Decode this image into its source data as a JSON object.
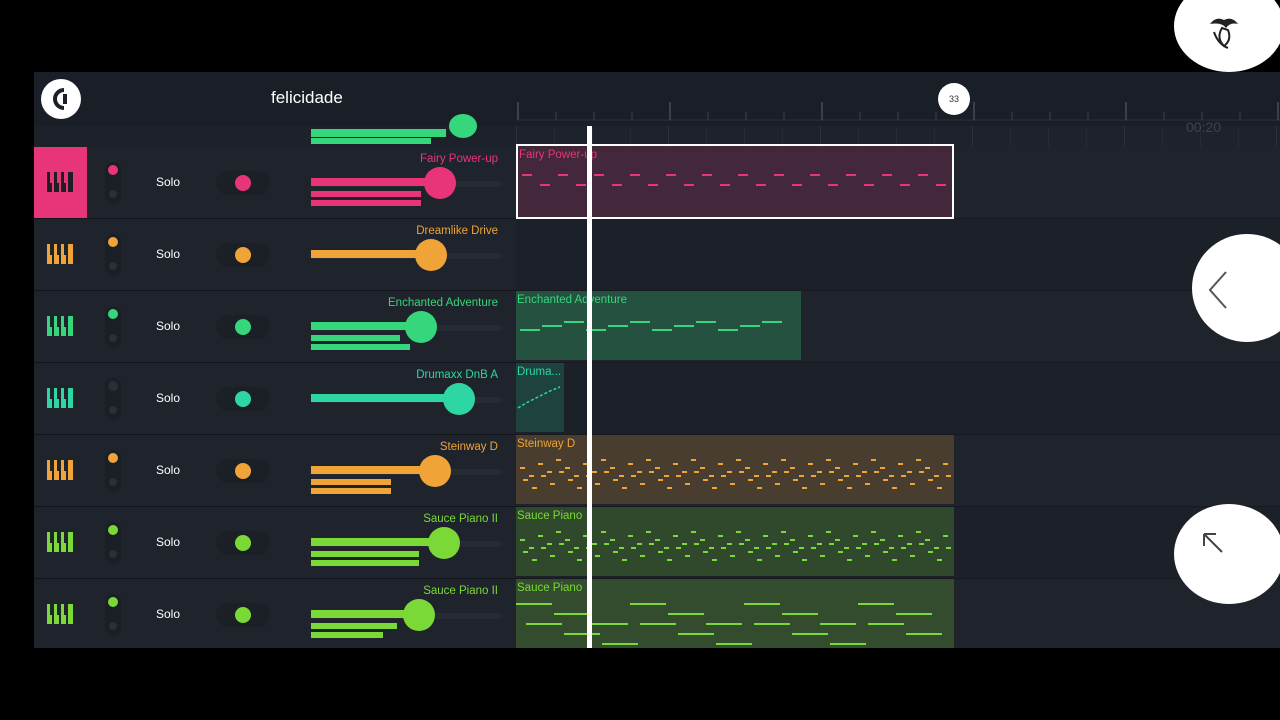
{
  "app": {
    "song_title": "felicidade",
    "bar_marker": "33",
    "time_display": "00:20"
  },
  "colors": {
    "pink": "#e8357a",
    "orange": "#f0a336",
    "green": "#36d67c",
    "teal": "#2ed6a3",
    "lime": "#7ad936"
  },
  "tracks": [
    {
      "name": "Fairy Power-up",
      "solo_label": "Solo",
      "color": "#e8357a",
      "selected": true,
      "volume": 0.68
    },
    {
      "name": "Dreamlike Drive",
      "solo_label": "Solo",
      "color": "#f0a336",
      "selected": false,
      "volume": 0.63
    },
    {
      "name": "Enchanted Adventure",
      "solo_label": "Solo",
      "color": "#36d67c",
      "selected": false,
      "volume": 0.58
    },
    {
      "name": "Drumaxx DnB A",
      "solo_label": "Solo",
      "color": "#2ed6a3",
      "selected": false,
      "volume": 0.78
    },
    {
      "name": "Steinway D",
      "solo_label": "Solo",
      "color": "#f0a336",
      "selected": false,
      "volume": 0.65
    },
    {
      "name": "Sauce Piano II",
      "solo_label": "Solo",
      "color": "#7ad936",
      "selected": false,
      "volume": 0.7
    },
    {
      "name": "Sauce Piano II",
      "solo_label": "Solo",
      "color": "#7ad936",
      "selected": false,
      "volume": 0.57
    }
  ],
  "clips": [
    {
      "label": "Fairy Power-up"
    },
    {
      "label": "Enchanted Adventure"
    },
    {
      "label": "Druma..."
    },
    {
      "label": "Steinway D"
    },
    {
      "label": "Sauce Piano"
    },
    {
      "label": "Sauce Piano"
    }
  ]
}
